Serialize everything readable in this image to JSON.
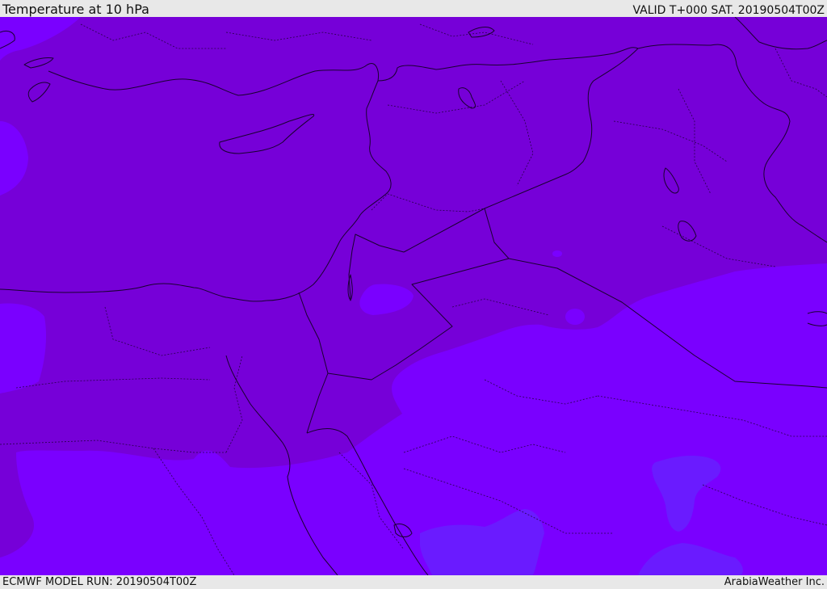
{
  "header": {
    "title": "Temperature at 10 hPa",
    "valid": "VALID T+000 SAT. 20190504T00Z"
  },
  "footer": {
    "model_run": "ECMWF MODEL RUN: 20190504T00Z",
    "credit": "ArabiaWeather Inc."
  },
  "map": {
    "colors": {
      "warm_band": "#7600d8",
      "cool_band": "#7a00ff",
      "coldest_band": "#6a1bff",
      "border_line": "#1a0030"
    }
  }
}
